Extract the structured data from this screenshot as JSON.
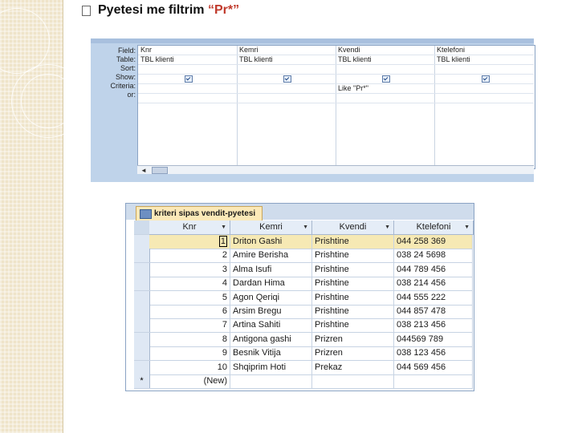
{
  "slide": {
    "title_main": "Pyetesi me filtrim ",
    "title_quote": "“Pr*”"
  },
  "query_design": {
    "row_labels": [
      "Field:",
      "Table:",
      "Sort:",
      "Show:",
      "Criteria:",
      "or:"
    ],
    "columns": [
      {
        "field": "Knr",
        "table": "TBL klienti",
        "sort": "",
        "show": true,
        "criteria": "",
        "or": ""
      },
      {
        "field": "Kemri",
        "table": "TBL klienti",
        "sort": "",
        "show": true,
        "criteria": "",
        "or": ""
      },
      {
        "field": "Kvendi",
        "table": "TBL klienti",
        "sort": "",
        "show": true,
        "criteria": "Like \"Pr*\"",
        "or": ""
      },
      {
        "field": "Ktelefoni",
        "table": "TBL klienti",
        "sort": "",
        "show": true,
        "criteria": "",
        "or": ""
      }
    ],
    "scroll_left_icon": "left-arrow-icon"
  },
  "datasheet": {
    "tab_label": "kriteri sipas vendit-pyetesi",
    "tab_icon": "query-icon",
    "headers": [
      "Knr",
      "Kemri",
      "Kvendi",
      "Ktelefoni"
    ],
    "rows": [
      {
        "knr": "1",
        "kemri": "Driton Gashi",
        "kvendi": "Prishtine",
        "ktel": "044 258 369"
      },
      {
        "knr": "2",
        "kemri": "Amire Berisha",
        "kvendi": "Prishtine",
        "ktel": "038 24 5698"
      },
      {
        "knr": "3",
        "kemri": "Alma Isufi",
        "kvendi": "Prishtine",
        "ktel": "044 789 456"
      },
      {
        "knr": "4",
        "kemri": "Dardan Hima",
        "kvendi": "Prishtine",
        "ktel": "038 214 456"
      },
      {
        "knr": "5",
        "kemri": "Agon Qeriqi",
        "kvendi": "Prishtine",
        "ktel": "044 555 222"
      },
      {
        "knr": "6",
        "kemri": "Arsim Bregu",
        "kvendi": "Prishtine",
        "ktel": "044 857 478"
      },
      {
        "knr": "7",
        "kemri": "Artina Sahiti",
        "kvendi": "Prishtine",
        "ktel": "038 213 456"
      },
      {
        "knr": "8",
        "kemri": "Antigona gashi",
        "kvendi": "Prizren",
        "ktel": "044569 789"
      },
      {
        "knr": "9",
        "kemri": "Besnik Vitija",
        "kvendi": "Prizren",
        "ktel": "038 123 456"
      },
      {
        "knr": "10",
        "kemri": "Shqiprim Hoti",
        "kvendi": "Prekaz",
        "ktel": "044 569 456"
      }
    ],
    "new_row_marker": "*",
    "new_row_label": "(New)"
  }
}
